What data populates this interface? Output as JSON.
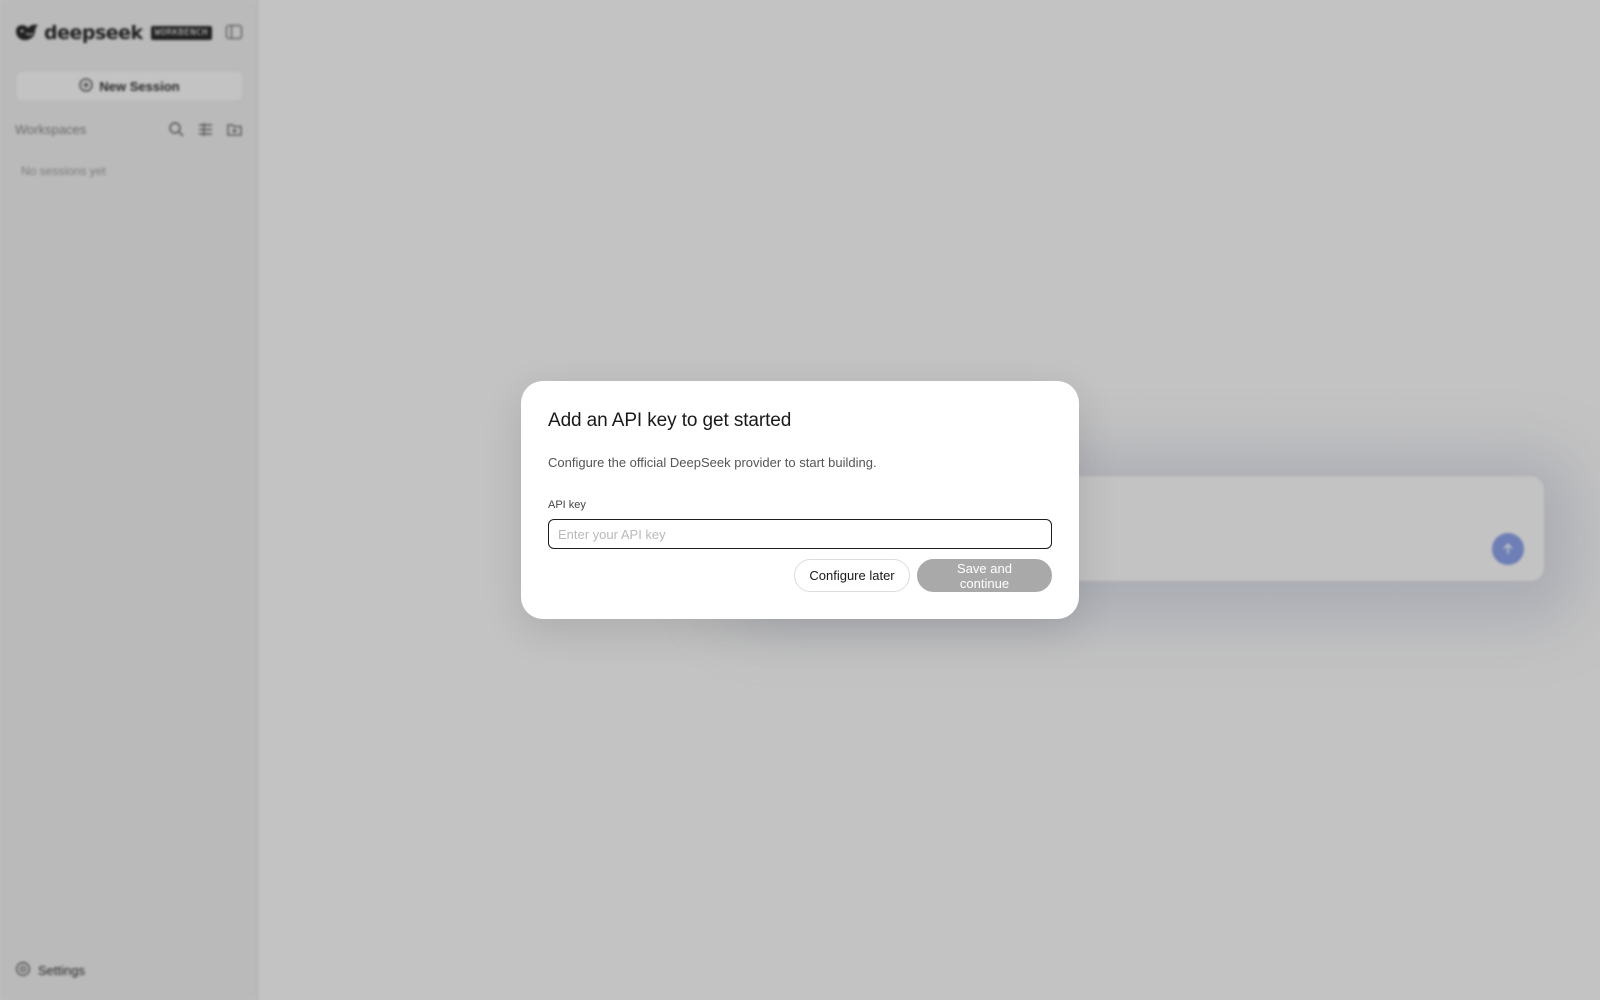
{
  "sidebar": {
    "brand_name": "deepseek",
    "brand_badge": "WORKBENCH",
    "new_session_label": "New Session",
    "workspaces_label": "Workspaces",
    "empty_state": "No sessions yet",
    "settings_label": "Settings"
  },
  "main": {
    "composer": {
      "send_icon": "arrow-up-icon",
      "send_color": "#8fa6ee"
    }
  },
  "modal": {
    "title": "Add an API key to get started",
    "description": "Configure the official DeepSeek provider to start building.",
    "field_label": "API key",
    "input_value": "",
    "input_placeholder": "Enter your API key",
    "configure_later_label": "Configure later",
    "save_label": "Save and continue",
    "save_disabled_color": "#a9a9a9"
  }
}
